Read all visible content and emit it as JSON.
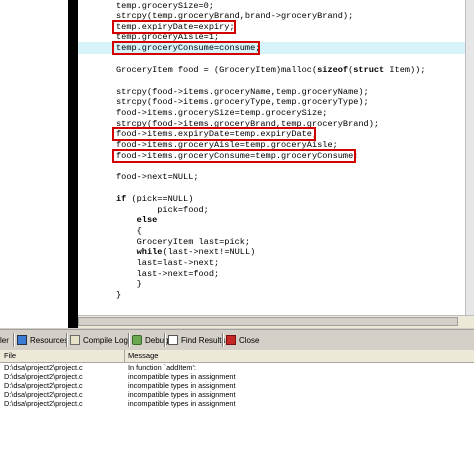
{
  "code": {
    "lines": [
      "temp.grocerySize=0;",
      "strcpy(temp.groceryBrand,brand->groceryBrand);",
      "temp.expiryDate=expiry;",
      "temp.groceryAisle=1;",
      "temp.groceryConsume=consume;",
      "",
      "GroceryItem food = (GroceryItem)malloc(",
      "",
      "strcpy(food->items.groceryName,temp.groceryName);",
      "strcpy(food->items.groceryType,temp.groceryType);",
      "food->items.grocerySize=temp.grocerySize;",
      "strcpy(food->items.groceryBrand,temp.groceryBrand);",
      "food->items.expiryDate=temp.expiryDate;",
      "food->items.groceryAisle=temp.groceryAisle;",
      "food->items.groceryConsume=temp.groceryConsume;",
      "",
      "food->next=NULL;",
      "",
      "",
      "        pick=food;",
      "    ",
      "    {",
      "    GroceryItem last=pick;",
      "    ",
      "    last=last->next;",
      "    last->next=food;",
      "    }",
      "}"
    ],
    "line7_kw1": "sizeof",
    "line7_mid": "(",
    "line7_kw2": "struct",
    "line7_tail": " Item));",
    "line18_kw": "if",
    "line18_tail": " (pick==NULL)",
    "line20_kw": "else",
    "line23_kw": "while",
    "line23_tail": "(last->next!=NULL)"
  },
  "tabs": [
    {
      "label": "ler"
    },
    {
      "label": "Resources"
    },
    {
      "label": "Compile Log"
    },
    {
      "label": "Debug"
    },
    {
      "label": "Find Results"
    },
    {
      "label": "Close"
    }
  ],
  "messages": {
    "headers": {
      "file": "File",
      "message": "Message"
    },
    "rows": [
      {
        "file": "D:\\dsa\\project2\\project.c",
        "message": "In function `addItem':"
      },
      {
        "file": "D:\\dsa\\project2\\project.c",
        "message": "incompatible types in assignment"
      },
      {
        "file": "D:\\dsa\\project2\\project.c",
        "message": "incompatible types in assignment"
      },
      {
        "file": "D:\\dsa\\project2\\project.c",
        "message": "incompatible types in assignment"
      },
      {
        "file": "D:\\dsa\\project2\\project.c",
        "message": "incompatible types in assignment"
      }
    ]
  },
  "colors": {
    "highlight_box": "#d40000",
    "current_line": "#d7f4fb"
  }
}
